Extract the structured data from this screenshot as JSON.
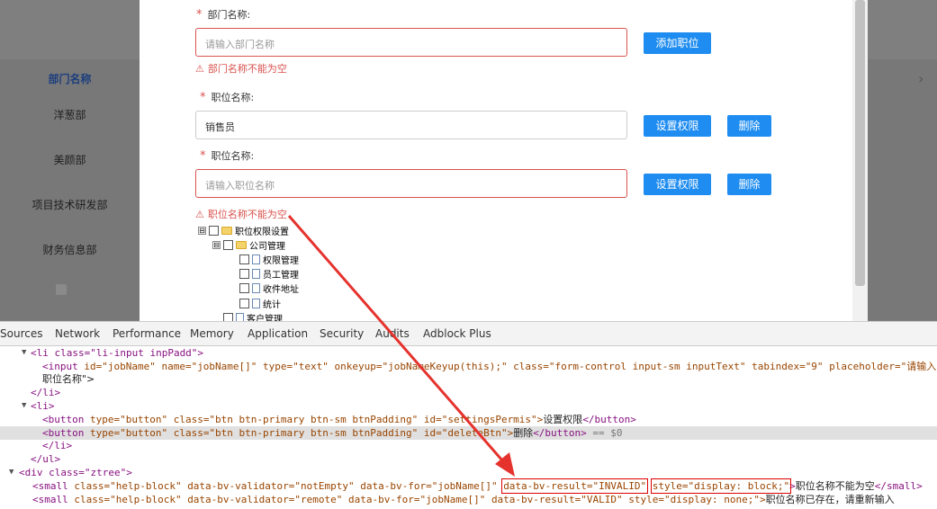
{
  "background_list": {
    "items": [
      {
        "label": "部门名称",
        "active": true
      },
      {
        "label": "洋葱部",
        "active": false
      },
      {
        "label": "美颜部",
        "active": false
      },
      {
        "label": "项目技术研发部",
        "active": false
      },
      {
        "label": "财务信息部",
        "active": false
      }
    ]
  },
  "form": {
    "dept": {
      "label": "部门名称:",
      "placeholder": "请输入部门名称",
      "error": "部门名称不能为空",
      "add_button": "添加职位"
    },
    "job1": {
      "label": "职位名称:",
      "value": "销售员",
      "perm_button": "设置权限",
      "delete_button": "删除"
    },
    "job2": {
      "label": "职位名称:",
      "placeholder": "请输入职位名称",
      "error": "职位名称不能为空",
      "perm_button": "设置权限",
      "delete_button": "删除"
    }
  },
  "tree": {
    "nodes": [
      {
        "label": "职位权限设置",
        "type": "folder",
        "switch": "⊟"
      },
      {
        "label": "公司管理",
        "type": "folder",
        "switch": "⊟"
      },
      {
        "label": "权限管理",
        "type": "file"
      },
      {
        "label": "员工管理",
        "type": "file"
      },
      {
        "label": "收件地址",
        "type": "file"
      },
      {
        "label": "统计",
        "type": "file"
      },
      {
        "label": "客户管理",
        "type": "file"
      }
    ]
  },
  "devtools": {
    "tabs": [
      "Sources",
      "Network",
      "Performance",
      "Memory",
      "Application",
      "Security",
      "Audits",
      "Adblock Plus"
    ],
    "code": {
      "l1_open": "<li class=\"li-input inpPadd\">",
      "l2_tag": "<input ",
      "l2_attrs": "id=\"jobName\" name=\"jobName[]\" type=\"text\" onkeyup=\"jobNameKeyup(this);\" class=\"form-control input-sm inputText\" tabindex=\"9\" placeholder=\"请输入",
      "l3_cont": "职位名称\">",
      "l4_close": "</li>",
      "l5_open": "<li>",
      "l6_tag": "<button ",
      "l6_attrs": "type=\"button\" class=\"btn btn-primary btn-sm btnPadding\" id=\"settingsPermis\">",
      "l6_text": "设置权限",
      "l6_end": "</button>",
      "l7_tag": "<button ",
      "l7_attrs": "type=\"button\" class=\"btn btn-primary btn-sm btnPadding\" id=\"deleteBtn\">",
      "l7_text": "删除",
      "l7_end": "</button>",
      "l7_eq": " == $0",
      "l8_close": "</li>",
      "l9_close": "</ul>",
      "l10_open": "<div class=\"ztree\">",
      "l11_tag": "<small ",
      "l11_attrs": "class=\"help-block\" data-bv-validator=\"notEmpty\" data-bv-for=\"jobName[]\" ",
      "l11_result": "data-bv-result=\"INVALID\"",
      "l11_style": "style=\"display: block;\"",
      "l11_gt": ">",
      "l11_text": "职位名称不能为空",
      "l11_end": "</small>",
      "l12_tag": "<small ",
      "l12_attrs": "class=\"help-block\" data-bv-validator=\"remote\" data-bv-for=\"jobName[]\" data-bv-result=\"VALID\" style=\"display: none;\">",
      "l12_text": "职位名称已存在，请重新输入"
    }
  },
  "colors": {
    "primary": "#1e8cf0",
    "error": "#d9534f",
    "annotation": "#e5322d"
  }
}
